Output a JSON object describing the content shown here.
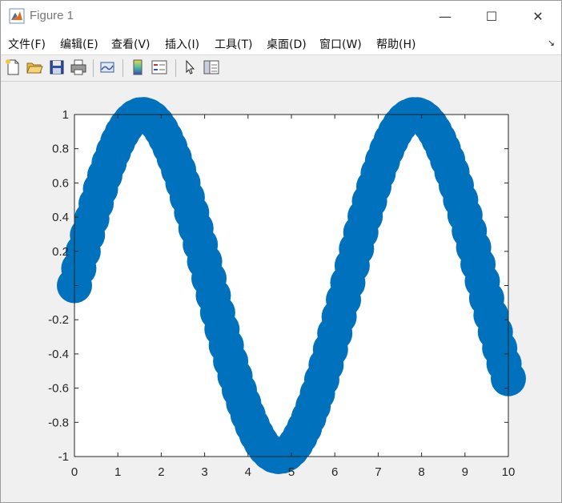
{
  "window": {
    "title": "Figure 1"
  },
  "title_controls": {
    "minimize": "—",
    "maximize": "☐",
    "close": "✕"
  },
  "menu": {
    "items": [
      "文件(F)",
      "编辑(E)",
      "查看(V)",
      "插入(I)",
      "工具(T)",
      "桌面(D)",
      "窗口(W)",
      "帮助(H)"
    ]
  },
  "toolbar": {
    "icons": [
      "new-figure-icon",
      "open-file-icon",
      "save-icon",
      "print-icon",
      "link-plot-icon",
      "colorbar-icon",
      "legend-icon",
      "pointer-icon",
      "property-inspector-icon"
    ]
  },
  "colors": {
    "marker": "#0072bd",
    "axes_bg": "#ffffff",
    "figure_bg": "#f0f0f0"
  },
  "chart_data": {
    "type": "scatter",
    "title": "",
    "xlabel": "",
    "ylabel": "",
    "function": "sin(x)",
    "x_range": [
      0,
      10
    ],
    "x_step": 0.1,
    "xlim": [
      0,
      10
    ],
    "ylim": [
      -1,
      1
    ],
    "xticks": [
      "0",
      "1",
      "2",
      "3",
      "4",
      "5",
      "6",
      "7",
      "8",
      "9",
      "10"
    ],
    "yticks": [
      "1",
      "0.8",
      "0.6",
      "0.4",
      "0.2",
      "",
      "-0.2",
      "-0.4",
      "-0.6",
      "-0.8",
      "-1"
    ],
    "marker": "filled circle",
    "grid": false,
    "legend": "none"
  }
}
